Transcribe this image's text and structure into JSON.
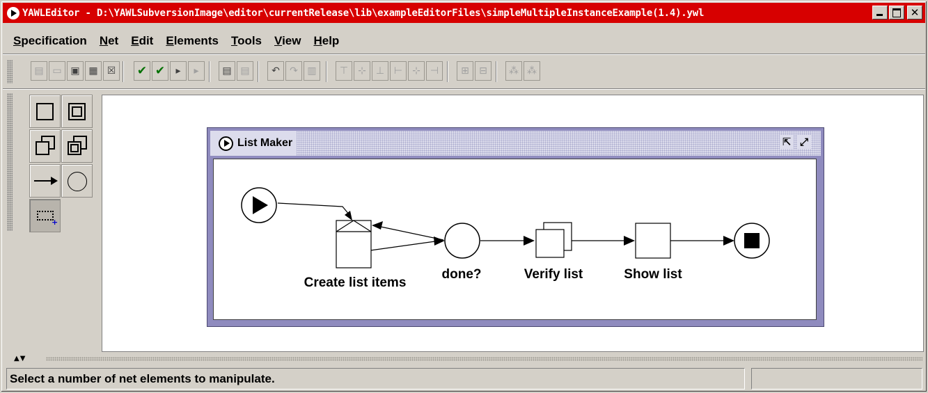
{
  "window": {
    "title": "YAWLEditor - D:\\YAWLSubversionImage\\editor\\currentRelease\\lib\\exampleEditorFiles\\simpleMultipleInstanceExample(1.4).ywl",
    "close_glyph": "✕"
  },
  "menubar": {
    "items": [
      {
        "mnemonic": "S",
        "rest": "pecification"
      },
      {
        "mnemonic": "N",
        "rest": "et"
      },
      {
        "mnemonic": "E",
        "rest": "dit"
      },
      {
        "mnemonic": "E",
        "rest": "lements"
      },
      {
        "mnemonic": "T",
        "rest": "ools"
      },
      {
        "mnemonic": "V",
        "rest": "iew"
      },
      {
        "mnemonic": "H",
        "rest": "elp"
      }
    ]
  },
  "toolbar": {
    "icons": [
      {
        "name": "new-specification-icon",
        "glyph": "▤",
        "state": "disabled"
      },
      {
        "name": "open-specification-icon",
        "glyph": "▭",
        "state": "disabled"
      },
      {
        "name": "save-specification-icon",
        "glyph": "▣",
        "state": "normal"
      },
      {
        "name": "save-as-icon",
        "glyph": "▦",
        "state": "normal"
      },
      {
        "name": "close-specification-icon",
        "glyph": "☒",
        "state": "normal"
      },
      {
        "name": "validate-icon",
        "glyph": "✔",
        "state": "active"
      },
      {
        "name": "analyse-icon",
        "glyph": "✔",
        "state": "active"
      },
      {
        "name": "export-icon",
        "glyph": "▸",
        "state": "normal"
      },
      {
        "name": "import-icon",
        "glyph": "▸",
        "state": "disabled"
      },
      {
        "name": "create-net-icon",
        "glyph": "▤",
        "state": "normal"
      },
      {
        "name": "remove-net-icon",
        "glyph": "▤",
        "state": "disabled"
      },
      {
        "name": "undo-icon",
        "glyph": "↶",
        "state": "normal"
      },
      {
        "name": "redo-icon",
        "glyph": "↷",
        "state": "disabled"
      },
      {
        "name": "delete-icon",
        "glyph": "▥",
        "state": "disabled"
      },
      {
        "name": "align-top-icon",
        "glyph": "⊤",
        "state": "disabled"
      },
      {
        "name": "align-middle-icon",
        "glyph": "⊹",
        "state": "disabled"
      },
      {
        "name": "align-bottom-icon",
        "glyph": "⊥",
        "state": "disabled"
      },
      {
        "name": "align-left-icon",
        "glyph": "⊢",
        "state": "disabled"
      },
      {
        "name": "align-center-icon",
        "glyph": "⊹",
        "state": "disabled"
      },
      {
        "name": "align-right-icon",
        "glyph": "⊣",
        "state": "disabled"
      },
      {
        "name": "increase-size-icon",
        "glyph": "⊞",
        "state": "disabled"
      },
      {
        "name": "decrease-size-icon",
        "glyph": "⊟",
        "state": "disabled"
      },
      {
        "name": "add-cancellation-set-icon",
        "glyph": "⁂",
        "state": "disabled"
      },
      {
        "name": "remove-cancellation-set-icon",
        "glyph": "⁂",
        "state": "disabled"
      }
    ]
  },
  "palette": {
    "tools": [
      {
        "name": "atomic-task-tool"
      },
      {
        "name": "composite-task-tool"
      },
      {
        "name": "multiple-atomic-task-tool"
      },
      {
        "name": "multiple-composite-task-tool"
      },
      {
        "name": "flow-relation-tool"
      },
      {
        "name": "condition-tool"
      },
      {
        "name": "marquee-select-tool"
      }
    ]
  },
  "net": {
    "title": "List Maker",
    "minimize_glyph": "⇱",
    "maximize_glyph": "⤢",
    "elements": {
      "create_list_items": "Create list items",
      "done": "done?",
      "verify_list": "Verify list",
      "show_list": "Show list"
    }
  },
  "splitter": {
    "arrows": "▲▼"
  },
  "statusbar": {
    "message": "Select a number of net elements to manipulate.",
    "extra": ""
  }
}
